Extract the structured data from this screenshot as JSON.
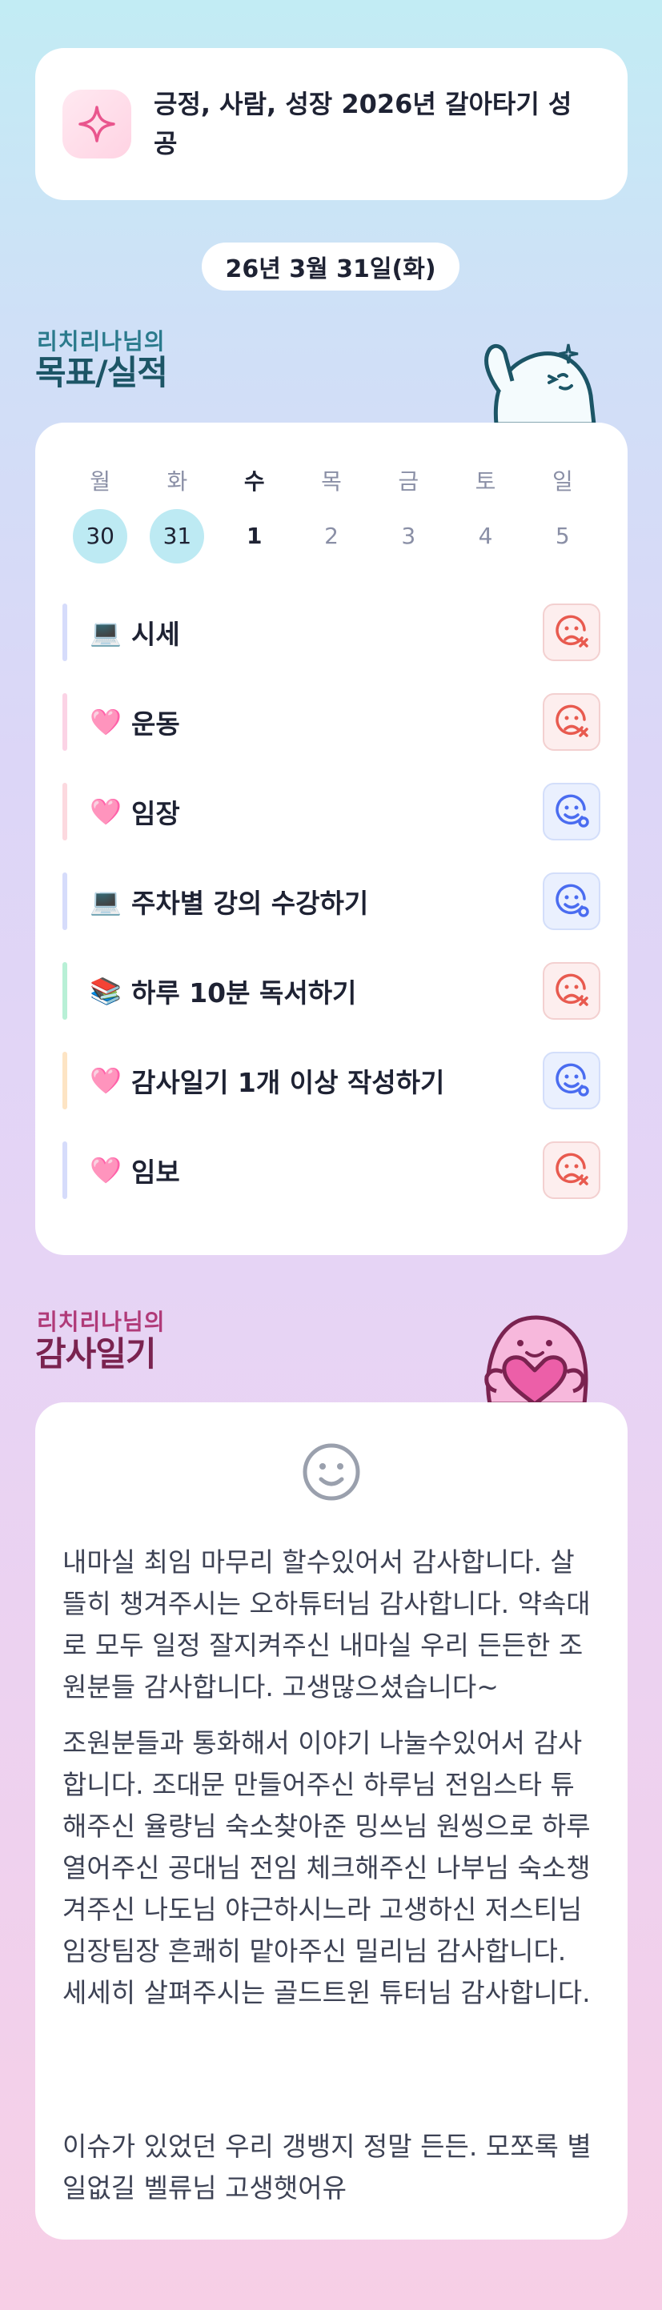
{
  "goal_banner": {
    "text": "긍정, 사람, 성장 2026년 갈아타기 성공",
    "icon": "sparkle-icon"
  },
  "date": "26년 3월 31일(화)",
  "goals_section": {
    "subtitle": "리치리나님의",
    "title": "목표/실적"
  },
  "week": [
    {
      "name": "월",
      "num": "30"
    },
    {
      "name": "화",
      "num": "31"
    },
    {
      "name": "수",
      "num": "1"
    },
    {
      "name": "목",
      "num": "2"
    },
    {
      "name": "금",
      "num": "3"
    },
    {
      "name": "토",
      "num": "4"
    },
    {
      "name": "일",
      "num": "5"
    }
  ],
  "goals": [
    {
      "emoji": "💻",
      "label": "시세",
      "status": "fail",
      "bar": "#d6dcfb"
    },
    {
      "emoji": "🩷",
      "label": "운동",
      "status": "fail",
      "bar": "#fbd3e5"
    },
    {
      "emoji": "🩷",
      "label": "임장",
      "status": "ok",
      "bar": "#fcd9df"
    },
    {
      "emoji": "💻",
      "label": "주차별 강의 수강하기",
      "status": "ok",
      "bar": "#d6dcfb"
    },
    {
      "emoji": "📚",
      "label": "하루 10분 독서하기",
      "status": "fail",
      "bar": "#b8f0d6"
    },
    {
      "emoji": "🩷",
      "label": "감사일기 1개 이상 작성하기",
      "status": "ok",
      "bar": "#fde4c4"
    },
    {
      "emoji": "🩷",
      "label": "임보",
      "status": "fail",
      "bar": "#d6dcfb"
    }
  ],
  "diary_section": {
    "subtitle": "리치리나님의",
    "title": "감사일기"
  },
  "diary": {
    "icon": "smile-icon",
    "p1": "내마실 최임 마무리 할수있어서 감사합니다. 살뜰히 챙겨주시는 오하튜터님 감사합니다. 약속대로 모두 일정 잘지켜주신 내마실 우리 든든한 조원분들 감사합니다. 고생많으셨습니다~",
    "p2": "조원분들과 통화해서 이야기 나눌수있어서 감사합니다. 조대문 만들어주신 하루님 전임스타 튜해주신 율량님 숙소찾아준 밍쓰님 원씽으로 하루 열어주신 공대님 전임 체크해주신 나부님 숙소챙겨주신 나도님 야근하시느라 고생하신 저스티님 임장팀장 흔쾌히 맡아주신 밀리님 감사합니다. 세세히 살펴주시는 골드트윈 튜터님 감사합니다.",
    "p3": "이슈가 있었던 우리 갱뱅지 정말 든든. 모쪼록 별일없길 벨류님 고생햇어유"
  },
  "colors": {
    "goals_title": "#1c5566",
    "diary_title": "#7a2350",
    "fail": "#e85a4f",
    "ok": "#4a6cf0"
  }
}
